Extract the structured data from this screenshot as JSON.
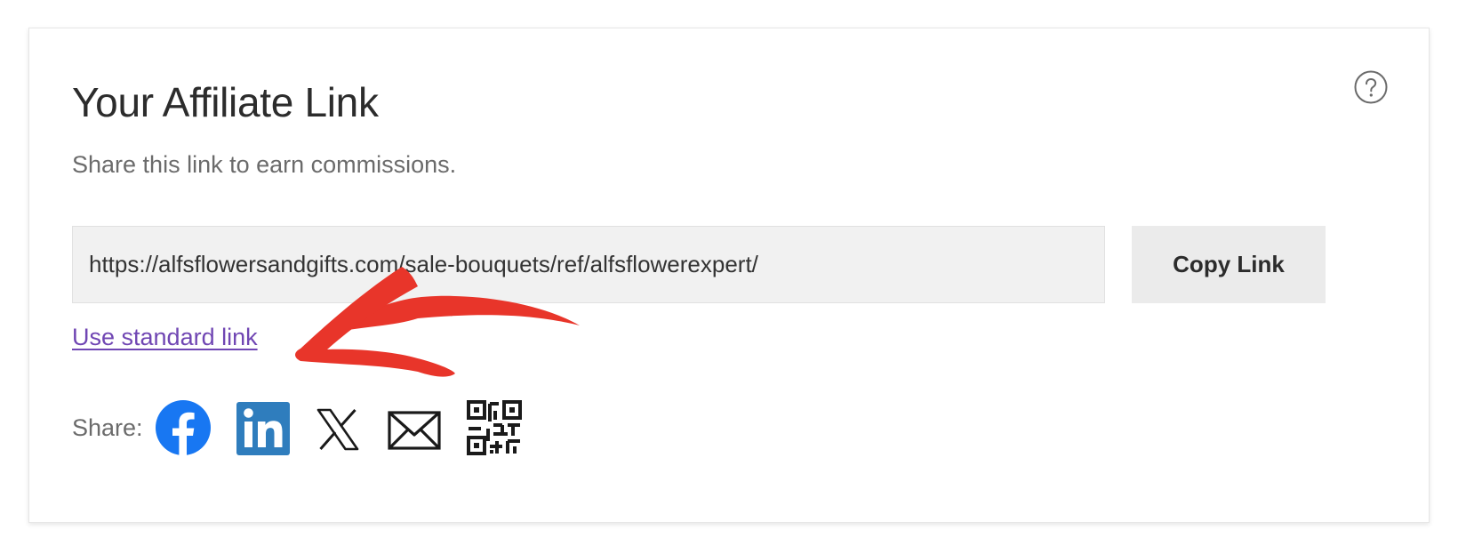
{
  "card": {
    "title": "Your Affiliate Link",
    "subtitle": "Share this link to earn commissions.",
    "help_icon": "question-circle-icon"
  },
  "link": {
    "value": "https://alfsflowersandgifts.com/sale-bouquets/ref/alfsflowerexpert/",
    "copy_label": "Copy Link",
    "standard_link_label": "Use standard link"
  },
  "share": {
    "label": "Share:",
    "icons": [
      "facebook-icon",
      "linkedin-icon",
      "x-icon",
      "email-icon",
      "qr-code-icon"
    ]
  },
  "colors": {
    "link_purple": "#7046b3",
    "facebook_blue": "#1877f2",
    "linkedin_blue": "#2f7dbd",
    "annotation_red": "#e8352a"
  }
}
